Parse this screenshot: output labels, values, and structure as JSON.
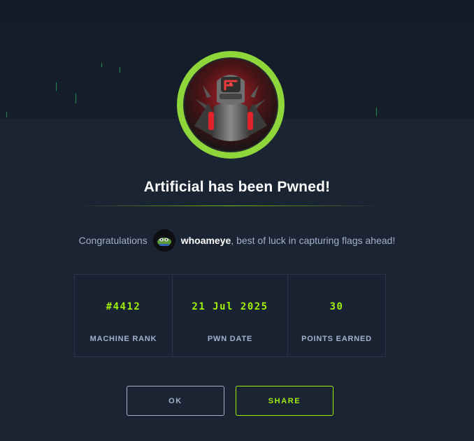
{
  "modal": {
    "title": "Artificial has been Pwned!",
    "congrats_prefix": "Congratulations",
    "username": "whoameye",
    "congrats_suffix": ", best of luck in capturing flags ahead!"
  },
  "stats": [
    {
      "value": "#4412",
      "label": "MACHINE RANK"
    },
    {
      "value": "21 Jul 2025",
      "label": "PWN DATE"
    },
    {
      "value": "30",
      "label": "POINTS EARNED"
    }
  ],
  "buttons": {
    "ok_label": "OK",
    "share_label": "SHARE"
  },
  "colors": {
    "accent": "#9fef00",
    "background": "#1b2433",
    "text_muted": "#a4b1cd"
  },
  "icons": {
    "badge": "machine-badge-icon",
    "avatar": "user-avatar-icon"
  }
}
